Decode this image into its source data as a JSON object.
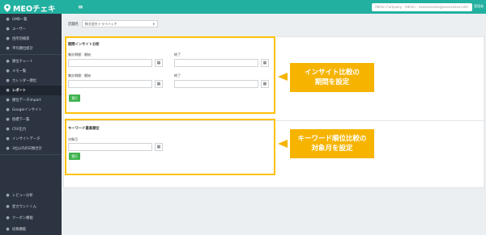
{
  "header": {
    "app_name": "MEOチェキ",
    "menu_icon": "hamburger-icon",
    "account_text": "Admin Company - Admin - xxxxxxxxxxx@xxxxxxxxx.com",
    "logout_label": "管理者"
  },
  "sidebar": {
    "items": [
      {
        "label": "GMB一覧",
        "icon": "map-pin-icon"
      },
      {
        "label": "ユーザー",
        "icon": "user-icon"
      },
      {
        "label": "住所別検索",
        "icon": "search-icon"
      },
      {
        "label": "平均順位統計",
        "icon": "chart-icon"
      },
      {
        "label": "順位チャート",
        "icon": "line-chart-icon"
      },
      {
        "label": "メモ一覧",
        "icon": "pencil-icon"
      },
      {
        "label": "カレンダー順位",
        "icon": "calendar-icon"
      },
      {
        "label": "レポート",
        "icon": "document-icon"
      },
      {
        "label": "順位データimport",
        "icon": "upload-icon"
      },
      {
        "label": "Googleインサイト",
        "icon": "google-icon"
      },
      {
        "label": "指標下一覧",
        "icon": "list-icon"
      },
      {
        "label": "CSV出力",
        "icon": "download-icon"
      },
      {
        "label": "インサイトデータ",
        "icon": "database-icon"
      },
      {
        "label": "3位以内の日数合計",
        "icon": "sum-icon"
      },
      {
        "label": "レビュー分析",
        "icon": "star-icon"
      },
      {
        "label": "星カウントくん",
        "icon": "star-count-icon"
      },
      {
        "label": "クーポン機能",
        "icon": "ticket-icon"
      },
      {
        "label": "投稿機能",
        "icon": "post-icon"
      }
    ],
    "active_label": "レポート"
  },
  "store": {
    "label": "店舗名",
    "selected": "株式会社トライハッチ"
  },
  "insight_panel": {
    "title": "期間インサイト分析",
    "period1_start_label": "集計期間：開始",
    "period1_end_label": "終了",
    "period2_start_label": "集計期間：開始",
    "period2_end_label": "終了",
    "run_label": "実行"
  },
  "keyword_panel": {
    "title": "キーワード最高順位",
    "month_label": "対象月",
    "run_label": "実行"
  },
  "annotations": {
    "callout1_line1": "インサイト比較の",
    "callout1_line2": "期間を設定",
    "callout2_line1": "キーワード順位比較の",
    "callout2_line2": "対象月を設定",
    "highlight_color": "#ffc107",
    "callout_color": "#f6b400"
  },
  "colors": {
    "header": "#22b0a0",
    "sidebar": "#2b3440",
    "run_button": "#3fb34f"
  }
}
